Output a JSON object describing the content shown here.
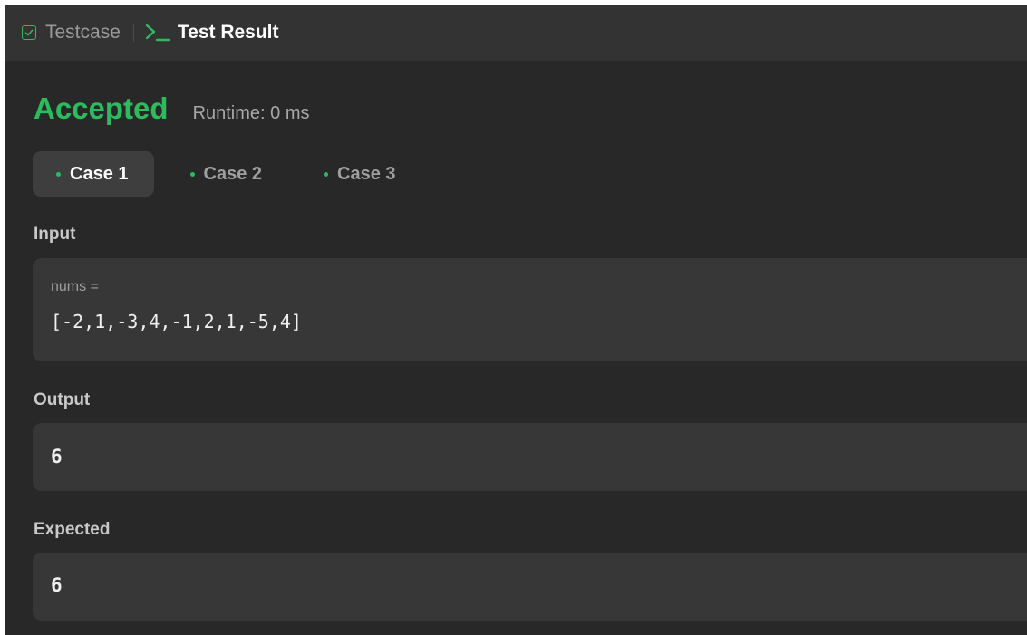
{
  "header": {
    "testcase_tab": "Testcase",
    "result_tab": "Test Result",
    "icons": {
      "testcase": "checkbox-icon",
      "result": "terminal-icon"
    }
  },
  "result": {
    "status": "Accepted",
    "runtime": "Runtime: 0 ms",
    "status_color": "#2cbb5d"
  },
  "cases": [
    {
      "label": "Case 1",
      "active": true
    },
    {
      "label": "Case 2",
      "active": false
    },
    {
      "label": "Case 3",
      "active": false
    }
  ],
  "input": {
    "label": "Input",
    "var_name": "nums =",
    "value": "[-2,1,-3,4,-1,2,1,-5,4]"
  },
  "output": {
    "label": "Output",
    "value": "6"
  },
  "expected": {
    "label": "Expected",
    "value": "6"
  }
}
